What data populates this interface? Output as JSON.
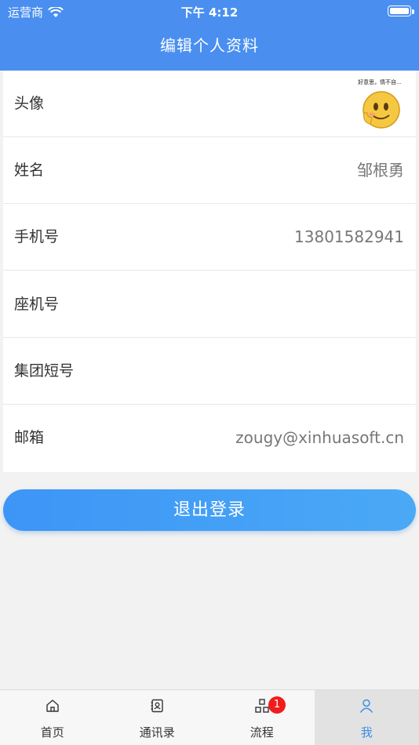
{
  "status_bar": {
    "carrier": "运营商",
    "time": "下午 4:12"
  },
  "header": {
    "title": "编辑个人资料"
  },
  "profile": {
    "avatar": {
      "label": "头像",
      "caption": "好意思，情不自..."
    },
    "name": {
      "label": "姓名",
      "value": "邹根勇"
    },
    "mobile": {
      "label": "手机号",
      "value": "13801582941"
    },
    "landline": {
      "label": "座机号",
      "value": ""
    },
    "group_short": {
      "label": "集团短号",
      "value": ""
    },
    "email": {
      "label": "邮箱",
      "value": "zougy@xinhuasoft.cn"
    }
  },
  "logout_label": "退出登录",
  "tabbar": {
    "tabs": [
      {
        "label": "首页",
        "icon": "home-icon"
      },
      {
        "label": "通讯录",
        "icon": "contacts-icon"
      },
      {
        "label": "流程",
        "icon": "workflow-icon",
        "badge": "1"
      },
      {
        "label": "我",
        "icon": "profile-icon",
        "active": true
      }
    ]
  },
  "colors": {
    "header": "#4a8ff0",
    "accent": "#3a8ee6",
    "badge": "#f01c1c"
  }
}
